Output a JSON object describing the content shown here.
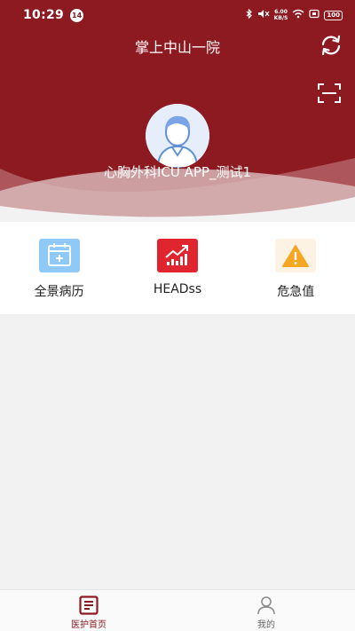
{
  "status_bar": {
    "time": "10:29",
    "notification_count": "14",
    "net_speed_value": "6.00",
    "net_speed_unit": "KB/S",
    "battery": "100"
  },
  "header": {
    "title": "掌上中山一院",
    "user_name": "心胸外科ICU APP_测试1"
  },
  "menu": {
    "items": [
      {
        "label": "全景病历",
        "icon": "calendar-record-icon",
        "color": "#8ec9f7"
      },
      {
        "label": "HEADss",
        "icon": "chart-trend-icon",
        "color": "#e0252f"
      },
      {
        "label": "危急值",
        "icon": "warning-icon",
        "color": "#f5a623"
      }
    ]
  },
  "bottom_nav": {
    "items": [
      {
        "label": "医护首页",
        "icon": "home-document-icon",
        "active": true
      },
      {
        "label": "我的",
        "icon": "profile-icon",
        "active": false
      }
    ]
  },
  "colors": {
    "brand": "#8c1a20",
    "background": "#f2f2f2"
  }
}
